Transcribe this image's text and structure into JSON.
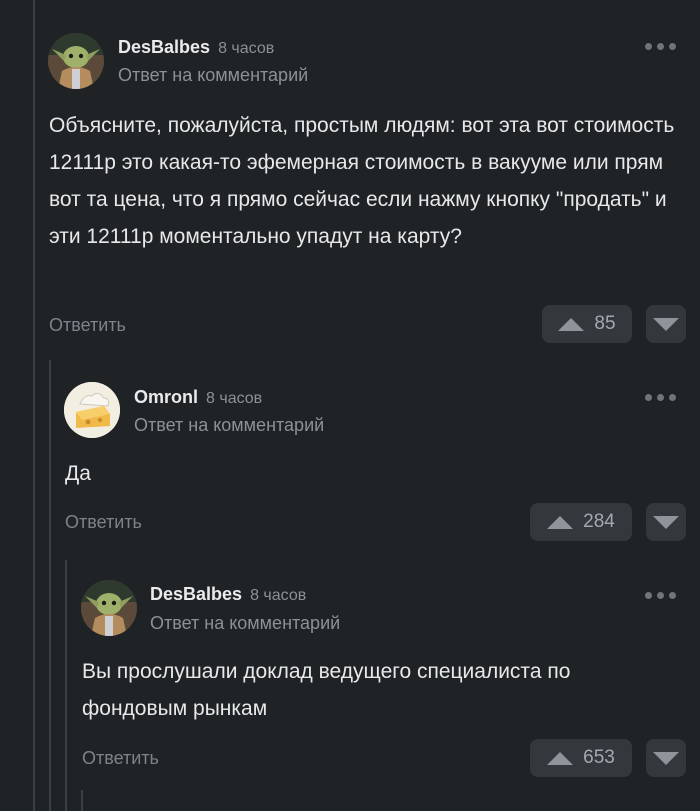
{
  "comments": [
    {
      "author": "DesBalbes",
      "time": "8 часов",
      "reply_label": "Ответ на комментарий",
      "avatar_icon": "yoda-avatar-icon",
      "text": "Объясните, пожалуйста, простым людям: вот эта вот стоимость 12111р это какая-то эфемерная стоимость в вакууме или прям вот та цена, что я прямо сейчас если нажму кнопку \"продать\" и эти 12111р моментально упадут на карту?",
      "reply_action": "Ответить",
      "votes": "85"
    },
    {
      "author": "Omronl",
      "time": "8 часов",
      "reply_label": "Ответ на комментарий",
      "avatar_icon": "cheese-avatar-icon",
      "text": "Да",
      "reply_action": "Ответить",
      "votes": "284"
    },
    {
      "author": "DesBalbes",
      "time": "8 часов",
      "reply_label": "Ответ на комментарий",
      "avatar_icon": "yoda-avatar-icon",
      "text": "Вы прослушали доклад ведущего специалиста по фондовым рынкам",
      "reply_action": "Ответить",
      "votes": "653"
    }
  ],
  "colors": {
    "background": "#1f2326",
    "button_bg": "#33383d",
    "muted_text": "#8b9197"
  }
}
